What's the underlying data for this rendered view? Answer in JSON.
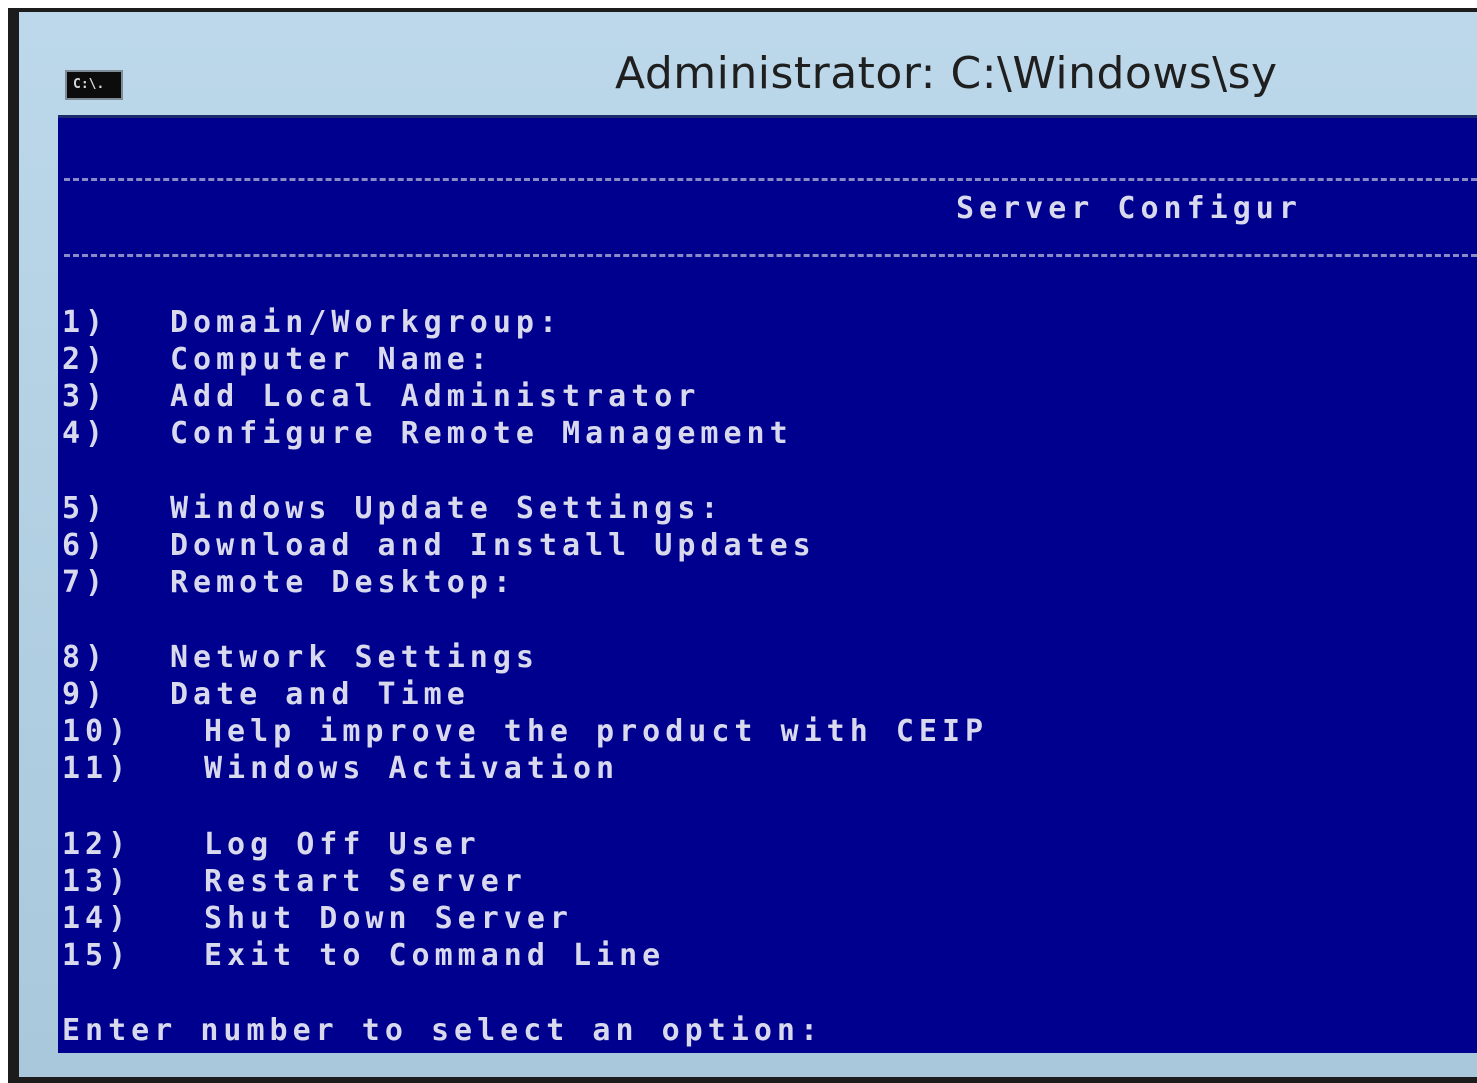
{
  "window": {
    "title": "Administrator: C:\\Windows\\sy",
    "icon_text": "C:\\."
  },
  "console": {
    "header": "Server Configur",
    "menu": [
      {
        "num": "1)",
        "label": "Domain/Workgroup:"
      },
      {
        "num": "2)",
        "label": "Computer Name:"
      },
      {
        "num": "3)",
        "label": "Add Local Administrator"
      },
      {
        "num": "4)",
        "label": "Configure Remote Management"
      },
      {
        "num": "5)",
        "label": "Windows Update Settings:"
      },
      {
        "num": "6)",
        "label": "Download and Install Updates"
      },
      {
        "num": "7)",
        "label": "Remote Desktop:"
      },
      {
        "num": "8)",
        "label": "Network Settings"
      },
      {
        "num": "9)",
        "label": "Date and Time"
      },
      {
        "num": "10)",
        "label": "Help improve the product with CEIP"
      },
      {
        "num": "11)",
        "label": "Windows Activation"
      },
      {
        "num": "12)",
        "label": "Log Off User"
      },
      {
        "num": "13)",
        "label": "Restart Server"
      },
      {
        "num": "14)",
        "label": "Shut Down Server"
      },
      {
        "num": "15)",
        "label": "Exit to Command Line"
      }
    ],
    "prompt": "Enter number to select an option:"
  },
  "colors": {
    "console_background": "#00008e",
    "console_text": "#d9d9ee",
    "frame": "#aecde0"
  }
}
